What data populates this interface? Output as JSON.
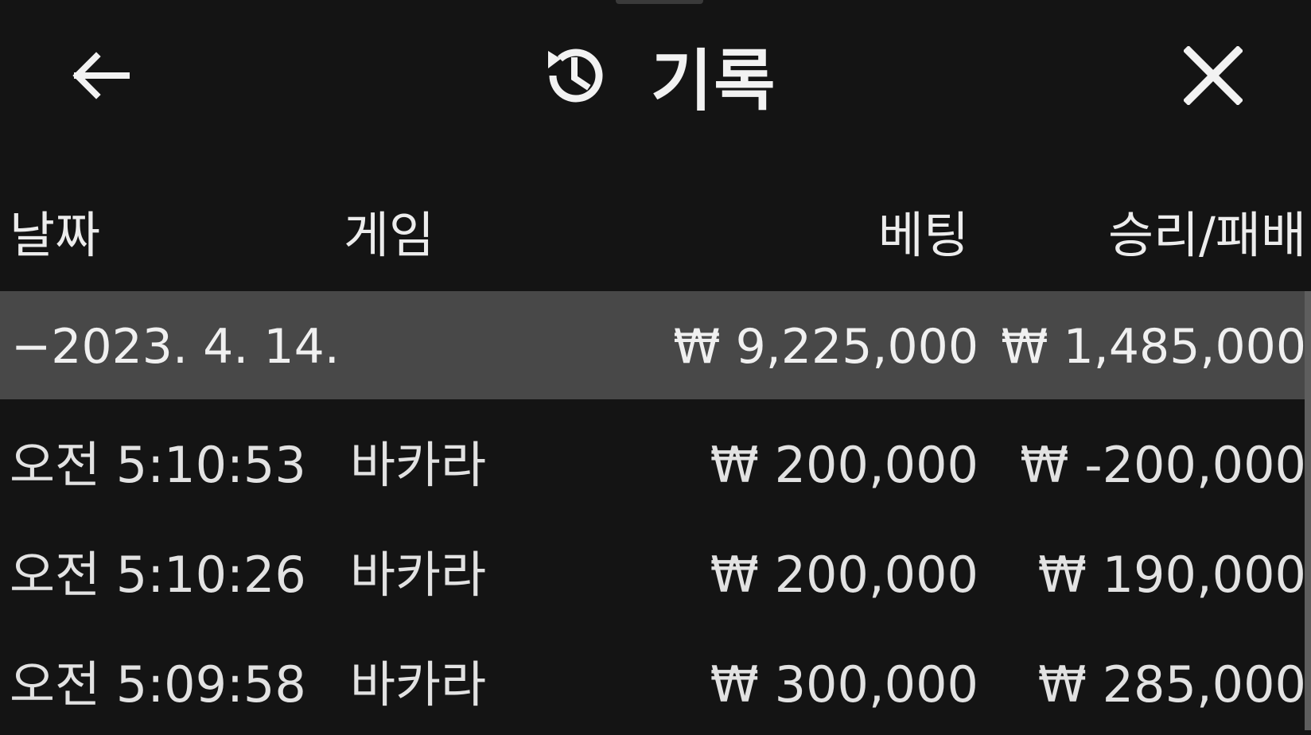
{
  "header": {
    "title": "기록",
    "back_icon": "arrow-left-icon",
    "history_icon": "history-icon",
    "close_icon": "close-icon"
  },
  "columns": {
    "date": "날짜",
    "game": "게임",
    "bet": "베팅",
    "result": "승리/패배"
  },
  "summary": {
    "date": "−2023. 4. 14.",
    "bet": "₩ 9,225,000",
    "result": "₩ 1,485,000"
  },
  "rows": [
    {
      "time": "오전 5:10:53",
      "game": "바카라",
      "bet": "₩ 200,000",
      "result": "₩ -200,000"
    },
    {
      "time": "오전 5:10:26",
      "game": "바카라",
      "bet": "₩ 200,000",
      "result": "₩ 190,000"
    },
    {
      "time": "오전 5:09:58",
      "game": "바카라",
      "bet": "₩ 300,000",
      "result": "₩ 285,000"
    }
  ],
  "colors": {
    "background": "#141414",
    "summary_row": "#484848",
    "text": "#e8e8e8"
  }
}
